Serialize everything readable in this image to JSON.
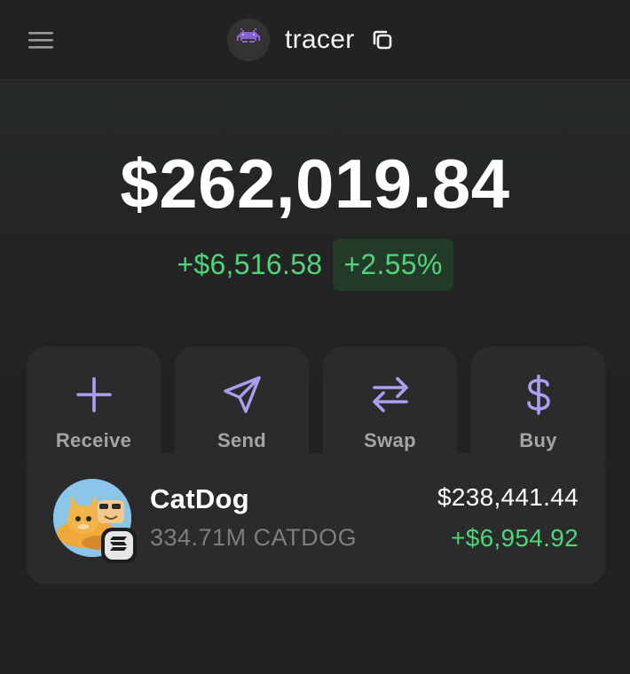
{
  "header": {
    "account_name": "tracer",
    "avatar_icon": "space-invader-icon",
    "menu_icon": "hamburger-menu-icon",
    "copy_icon": "copy-icon"
  },
  "portfolio": {
    "balance": "$262,019.84",
    "change_amount": "+$6,516.58",
    "change_percent": "+2.55%"
  },
  "actions": [
    {
      "label": "Receive",
      "icon": "plus-icon"
    },
    {
      "label": "Send",
      "icon": "send-icon"
    },
    {
      "label": "Swap",
      "icon": "swap-arrows-icon"
    },
    {
      "label": "Buy",
      "icon": "dollar-icon"
    }
  ],
  "tokens": [
    {
      "name": "CatDog",
      "amount": "334.71M CATDOG",
      "value": "$238,441.44",
      "change": "+$6,954.92",
      "chain_icon": "solana-icon"
    }
  ],
  "colors": {
    "background": "#222222",
    "card": "#2b2b2b",
    "accent": "#ab9ff2",
    "positive": "#4fd47c",
    "positive_bg": "#233a29"
  }
}
